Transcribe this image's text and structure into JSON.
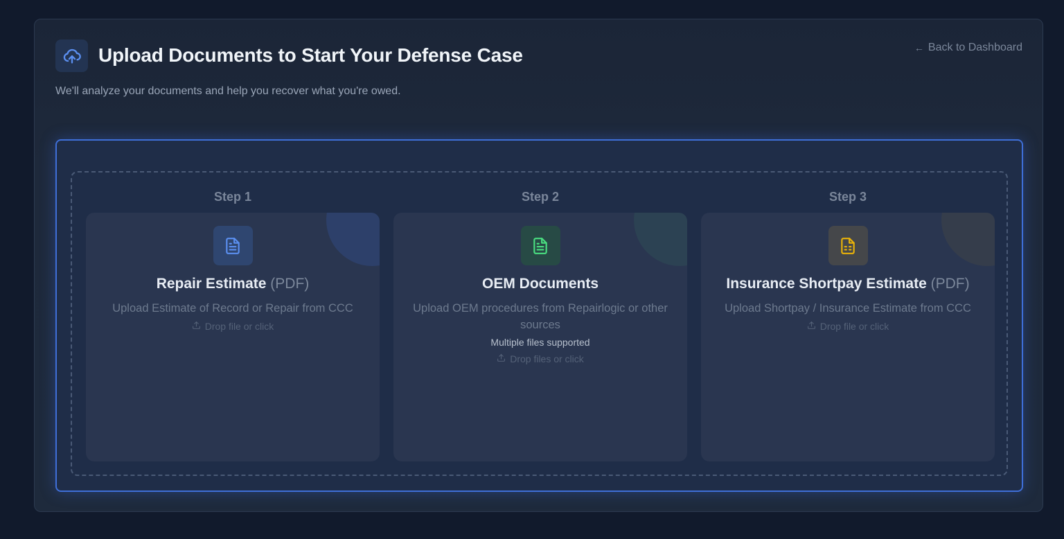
{
  "header": {
    "title": "Upload Documents to Start Your Defense Case",
    "subtitle": "We'll analyze your documents and help you recover what you're owed.",
    "back_link": "Back to Dashboard",
    "icon": "cloud-upload-icon"
  },
  "steps": [
    {
      "step_label": "Step 1",
      "title": "Repair Estimate",
      "format": "(PDF)",
      "description": "Upload Estimate of Record or Repair from CCC",
      "drop_text": "Drop file or click",
      "icon": "document-icon",
      "accent": "#5b8ff0"
    },
    {
      "step_label": "Step 2",
      "title": "OEM Documents",
      "format": "",
      "description": "Upload OEM procedures from Repairlogic or other sources",
      "note": "Multiple files supported",
      "drop_text": "Drop files or click",
      "icon": "document-icon",
      "accent": "#4ade80"
    },
    {
      "step_label": "Step 3",
      "title": "Insurance Shortpay Estimate",
      "format": "(PDF)",
      "description": "Upload Shortpay / Insurance Estimate from CCC",
      "drop_text": "Drop file or click",
      "icon": "spreadsheet-document-icon",
      "accent": "#eab308"
    }
  ],
  "colors": {
    "page_background": "#111a2c",
    "panel_background": "#1e293b",
    "upload_border": "#3f6fd8",
    "card_background": "#2a3650"
  }
}
